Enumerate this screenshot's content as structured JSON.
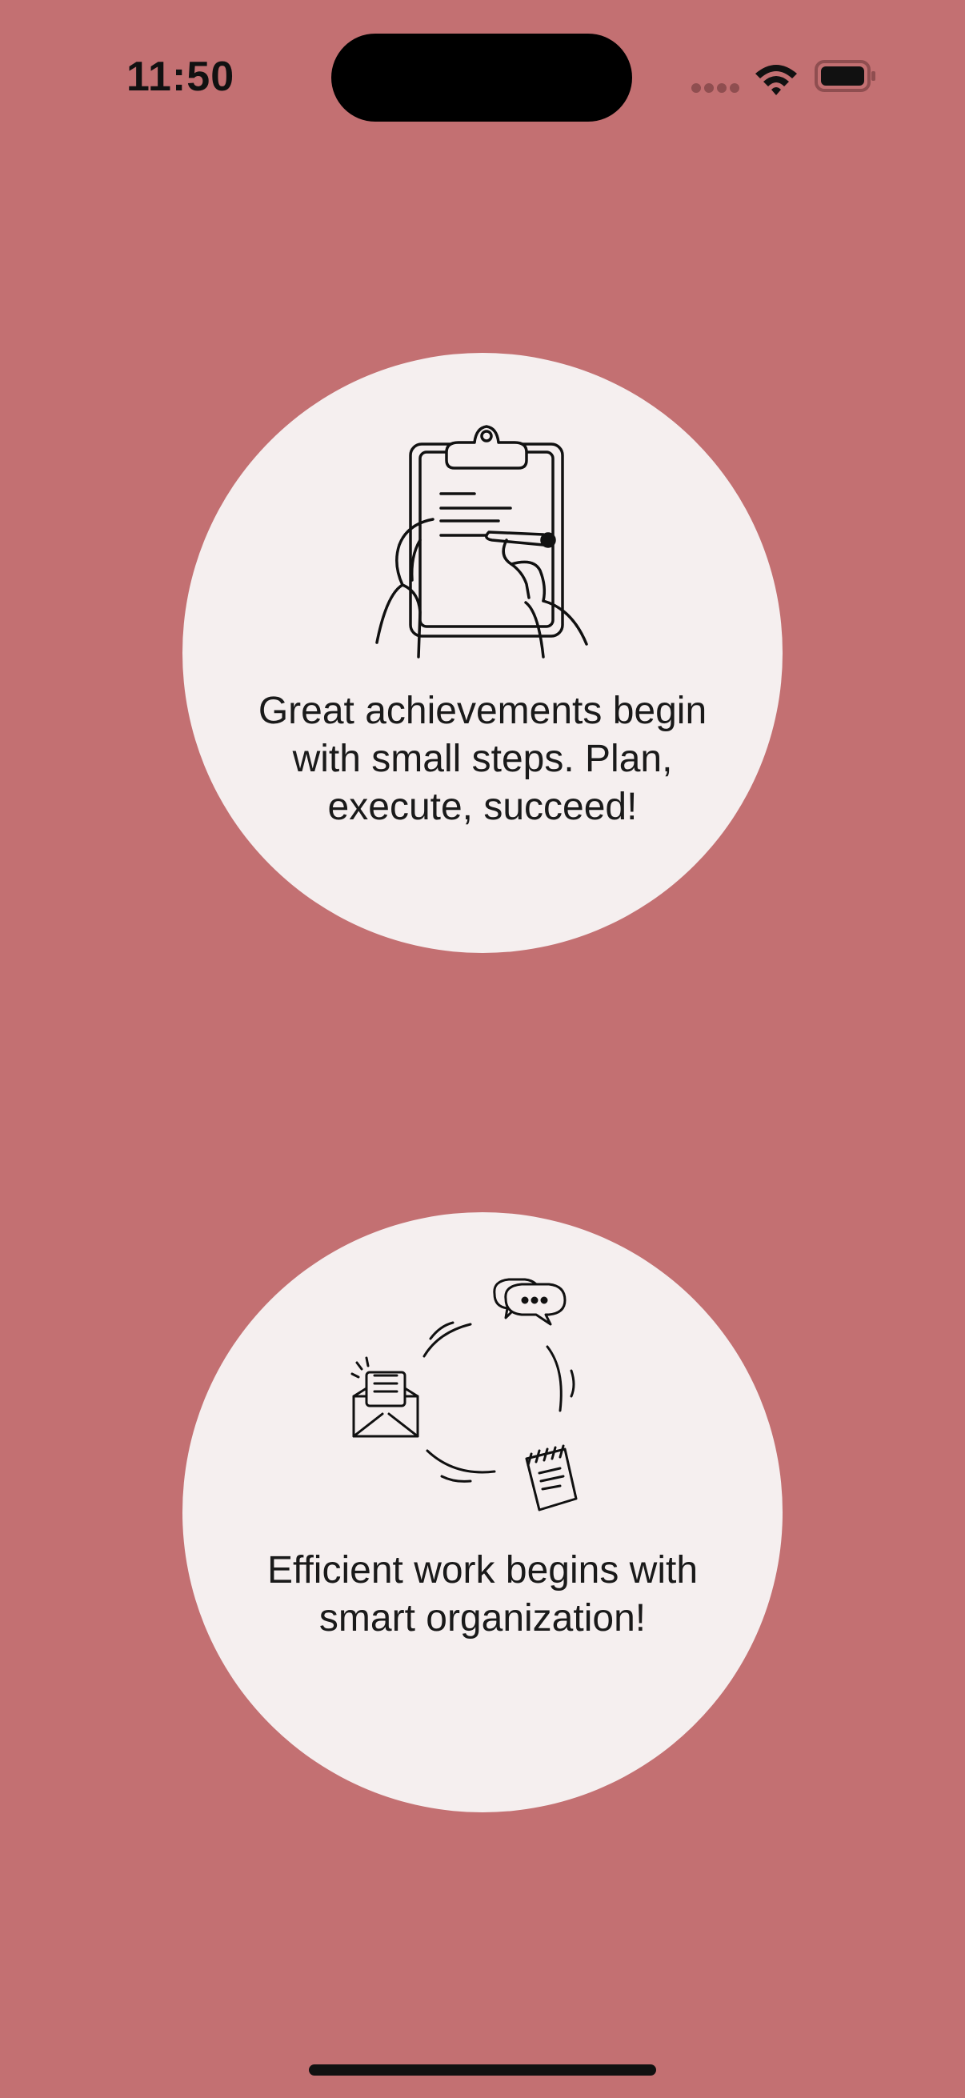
{
  "status_bar": {
    "time": "11:50"
  },
  "cards": [
    {
      "icon": "clipboard-writing-icon",
      "message": "Great achievements begin with small steps. Plan, execute, succeed!"
    },
    {
      "icon": "organization-cycle-icon",
      "message": "Efficient work begins with smart organization!"
    }
  ],
  "colors": {
    "background": "#c37072",
    "card": "#f5efef",
    "text": "#1a1a1a"
  }
}
